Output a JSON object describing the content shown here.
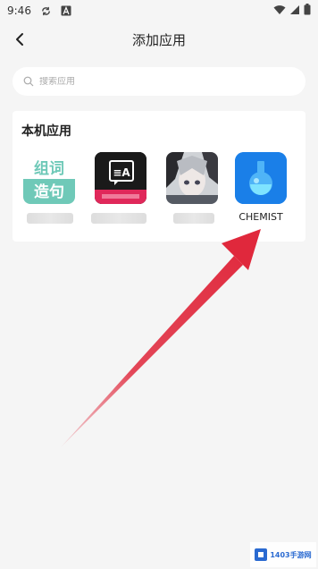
{
  "status_bar": {
    "time": "9:46",
    "icons": [
      "sync-icon",
      "a-box-icon",
      "wifi-icon",
      "signal-icon",
      "battery-icon"
    ]
  },
  "header": {
    "title": "添加应用",
    "back_icon": "chevron-left-icon"
  },
  "search": {
    "placeholder": "搜索应用",
    "icon": "search-icon"
  },
  "local_apps": {
    "title": "本机应用",
    "apps": [
      {
        "label": "",
        "icon_text": "组词造句",
        "icon": "app-icon-word",
        "label_blurred": true
      },
      {
        "label": "",
        "icon_text": "≡A",
        "icon": "app-icon-translate",
        "label_blurred": true
      },
      {
        "label": "",
        "icon_text": "",
        "icon": "app-icon-anime",
        "label_blurred": true
      },
      {
        "label": "CHEMIST",
        "icon_text": "",
        "icon": "flask-icon",
        "label_blurred": false
      }
    ]
  },
  "watermark": {
    "text": "1403手游网"
  },
  "colors": {
    "background": "#f5f5f5",
    "card": "#ffffff",
    "chemist_blue": "#1a7fe8",
    "arrow_red": "#e0283c"
  }
}
